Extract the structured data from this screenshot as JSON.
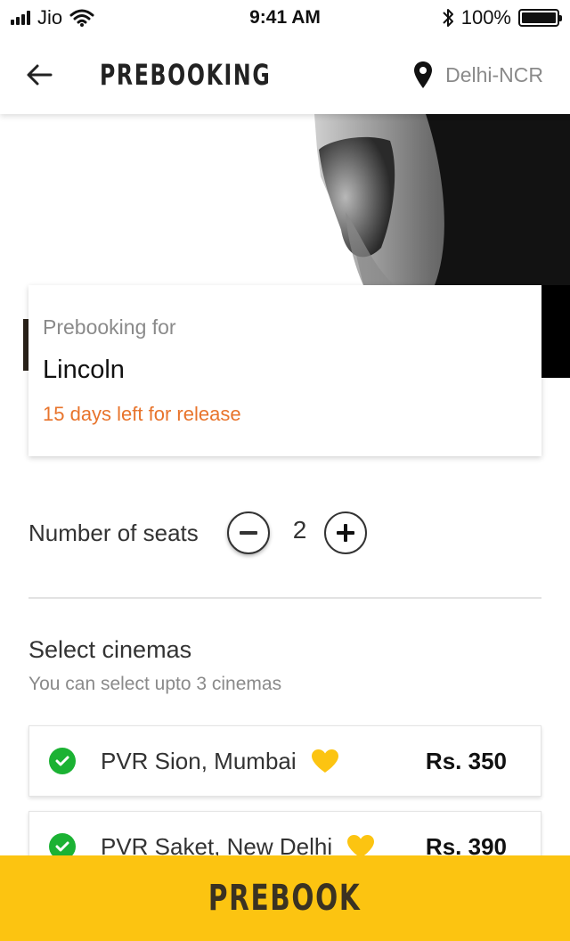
{
  "status_bar": {
    "carrier": "Jio",
    "time": "9:41 AM",
    "battery": "100%"
  },
  "header": {
    "title": "PREBOOKING",
    "location": "Delhi-NCR"
  },
  "movie": {
    "prebooking_label": "Prebooking for",
    "title": "Lincoln",
    "release_note": "15 days left for release"
  },
  "seats": {
    "label": "Number of seats",
    "count": "2"
  },
  "cinemas": {
    "title": "Select cinemas",
    "subtitle": "You can select upto 3 cinemas",
    "items": [
      {
        "name": "PVR Sion, Mumbai",
        "price": "Rs. 350",
        "selected": true,
        "favorite": true
      },
      {
        "name": "PVR Saket, New Delhi",
        "price": "Rs. 390",
        "selected": true,
        "favorite": true
      }
    ]
  },
  "cta": {
    "label": "PREBOOK"
  },
  "colors": {
    "accent": "#fcc411",
    "release_text": "#e8742c",
    "check": "#1bb233",
    "heart": "#fcc411"
  },
  "icons": {
    "back": "arrow-left-icon",
    "location": "map-pin-icon",
    "minus": "minus-icon",
    "plus": "plus-icon",
    "check": "check-circle-icon",
    "heart": "heart-icon"
  }
}
